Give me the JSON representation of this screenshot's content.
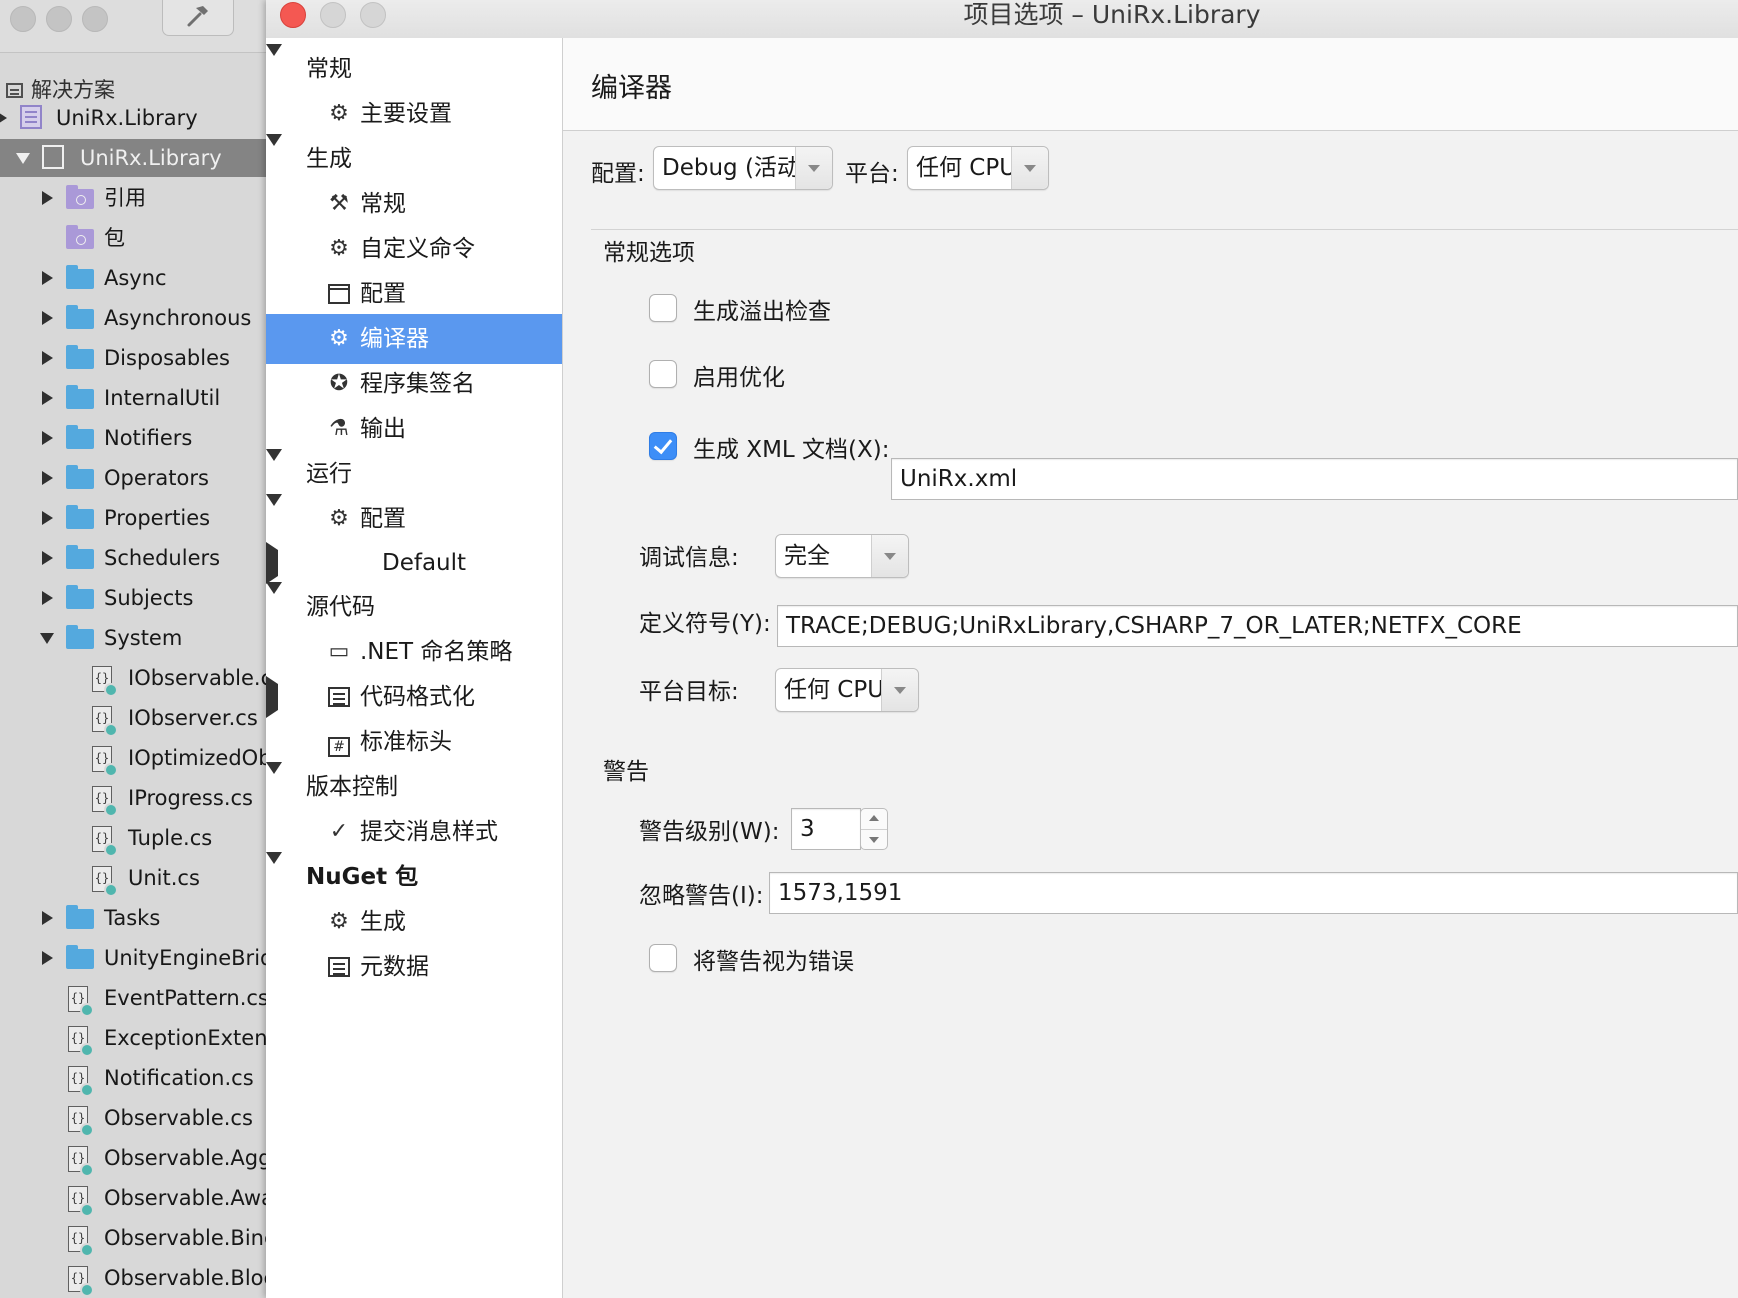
{
  "window": {
    "title": "项目选项 – UniRx.Library"
  },
  "solution_pad": {
    "header": "解决方案",
    "items": [
      {
        "label": "UniRx.Library",
        "kind": "project"
      },
      {
        "label": "UniRx.Library",
        "kind": "project-selected"
      },
      {
        "label": "引用",
        "kind": "folder-purple"
      },
      {
        "label": "包",
        "kind": "folder-purple"
      },
      {
        "label": "Async",
        "kind": "folder"
      },
      {
        "label": "Asynchronous",
        "kind": "folder"
      },
      {
        "label": "Disposables",
        "kind": "folder"
      },
      {
        "label": "InternalUtil",
        "kind": "folder"
      },
      {
        "label": "Notifiers",
        "kind": "folder"
      },
      {
        "label": "Operators",
        "kind": "folder"
      },
      {
        "label": "Properties",
        "kind": "folder"
      },
      {
        "label": "Schedulers",
        "kind": "folder"
      },
      {
        "label": "Subjects",
        "kind": "folder"
      },
      {
        "label": "System",
        "kind": "folder"
      },
      {
        "label": "IObservable.c",
        "kind": "file"
      },
      {
        "label": "IObserver.cs",
        "kind": "file"
      },
      {
        "label": "IOptimizedOb",
        "kind": "file"
      },
      {
        "label": "IProgress.cs",
        "kind": "file"
      },
      {
        "label": "Tuple.cs",
        "kind": "file"
      },
      {
        "label": "Unit.cs",
        "kind": "file"
      },
      {
        "label": "Tasks",
        "kind": "folder"
      },
      {
        "label": "UnityEngineBrid",
        "kind": "folder"
      },
      {
        "label": "EventPattern.cs",
        "kind": "file"
      },
      {
        "label": "ExceptionExtens",
        "kind": "file"
      },
      {
        "label": "Notification.cs",
        "kind": "file"
      },
      {
        "label": "Observable.cs",
        "kind": "file"
      },
      {
        "label": "Observable.Aggr",
        "kind": "file"
      },
      {
        "label": "Observable.Awa",
        "kind": "file"
      },
      {
        "label": "Observable.Binc",
        "kind": "file"
      },
      {
        "label": "Observable.Bloc",
        "kind": "file"
      }
    ]
  },
  "nav": {
    "items": [
      {
        "label": "常规",
        "kind": "category"
      },
      {
        "label": "主要设置",
        "kind": "item",
        "icon": "gear-icon"
      },
      {
        "label": "生成",
        "kind": "category"
      },
      {
        "label": "常规",
        "kind": "item",
        "icon": "hammer-icon"
      },
      {
        "label": "自定义命令",
        "kind": "item",
        "icon": "gear-icon"
      },
      {
        "label": "配置",
        "kind": "item",
        "icon": "window-icon"
      },
      {
        "label": "编译器",
        "kind": "item",
        "icon": "compiler-icon",
        "selected": true
      },
      {
        "label": "程序集签名",
        "kind": "item",
        "icon": "certificate-icon"
      },
      {
        "label": "输出",
        "kind": "item",
        "icon": "flask-icon"
      },
      {
        "label": "运行",
        "kind": "category"
      },
      {
        "label": "配置",
        "kind": "item",
        "icon": "gear-icon"
      },
      {
        "label": "Default",
        "kind": "subitem"
      },
      {
        "label": "源代码",
        "kind": "category"
      },
      {
        "label": ".NET 命名策略",
        "kind": "item",
        "icon": "naming-icon"
      },
      {
        "label": "代码格式化",
        "kind": "item",
        "icon": "format-icon"
      },
      {
        "label": "标准标头",
        "kind": "item",
        "icon": "hash-icon"
      },
      {
        "label": "版本控制",
        "kind": "category"
      },
      {
        "label": "提交消息样式",
        "kind": "item",
        "icon": "check-circle-icon"
      },
      {
        "label": "NuGet 包",
        "kind": "category"
      },
      {
        "label": "生成",
        "kind": "item",
        "icon": "gear-icon"
      },
      {
        "label": "元数据",
        "kind": "item",
        "icon": "list-icon"
      }
    ]
  },
  "panel": {
    "title": "编译器",
    "config_label": "配置:",
    "config_value": "Debug (活动)",
    "platform_label": "平台:",
    "platform_value": "任何 CPU",
    "general_section": "常规选项",
    "overflow_check_label": "生成溢出检查",
    "overflow_check": false,
    "optimize_label": "启用优化",
    "optimize": false,
    "xml_doc_label": "生成 XML 文档(X):",
    "xml_doc": true,
    "xml_doc_value": "UniRx.xml",
    "debug_info_label": "调试信息:",
    "debug_info_value": "完全",
    "define_symbols_label": "定义符号(Y):",
    "define_symbols_value": "TRACE;DEBUG;UniRxLibrary,CSHARP_7_OR_LATER;NETFX_CORE",
    "platform_target_label": "平台目标:",
    "platform_target_value": "任何 CPU",
    "warnings_section": "警告",
    "warning_level_label": "警告级别(W):",
    "warning_level_value": "3",
    "ignore_warnings_label": "忽略警告(I):",
    "ignore_warnings_value": "1573,1591",
    "warnings_as_errors_label": "将警告视为错误",
    "warnings_as_errors": false
  },
  "colors": {
    "close_button": "#f45852",
    "selection": "#5a98ef",
    "checkbox_checked": "#3d8ef7",
    "folder": "#5ab4ec"
  }
}
